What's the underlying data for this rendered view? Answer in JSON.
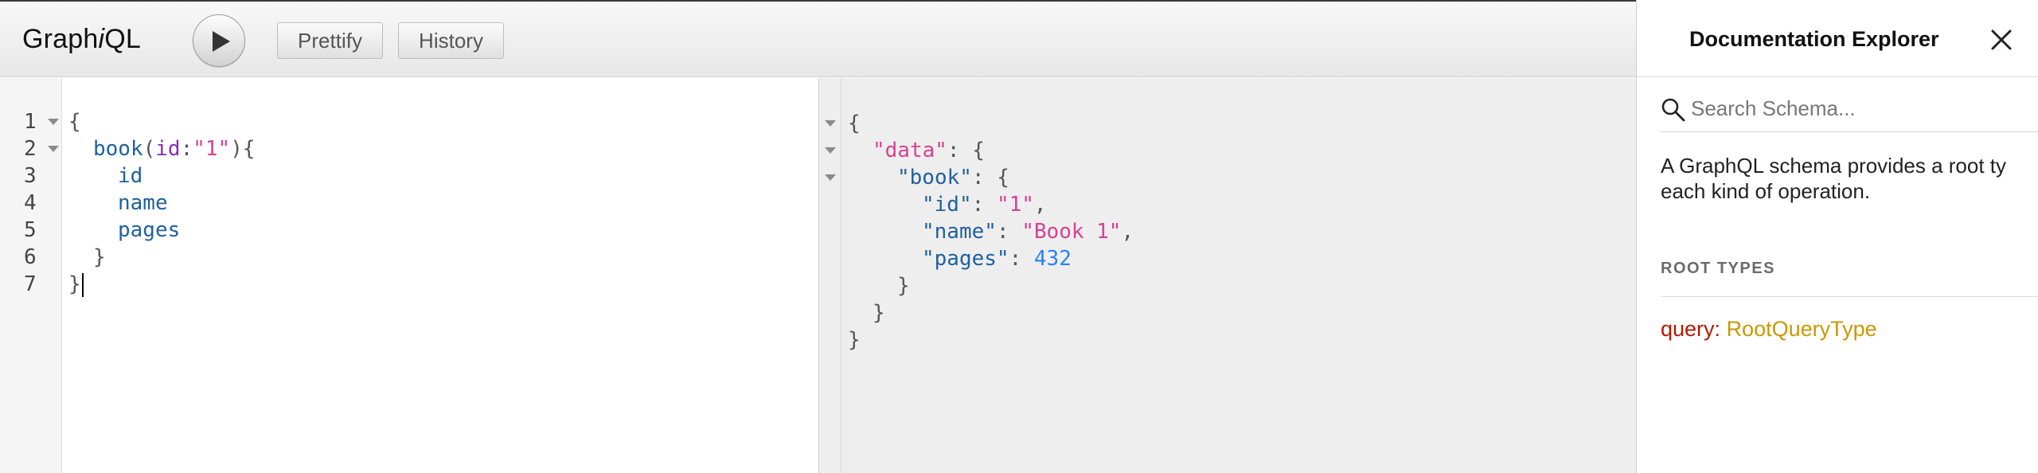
{
  "app": {
    "title_prefix": "Graph",
    "title_italic": "i",
    "title_suffix": "QL"
  },
  "toolbar": {
    "run_button": "play-icon",
    "prettify_label": "Prettify",
    "history_label": "History"
  },
  "query_editor": {
    "line_numbers": [
      "1",
      "2",
      "3",
      "4",
      "5",
      "6",
      "7"
    ],
    "lines": [
      {
        "tokens": [
          {
            "t": "{",
            "c": "punct"
          }
        ]
      },
      {
        "tokens": [
          {
            "t": "book",
            "c": "field"
          },
          {
            "t": "(",
            "c": "punct"
          },
          {
            "t": "id",
            "c": "arg"
          },
          {
            "t": ":",
            "c": "punct"
          },
          {
            "t": "\"1\"",
            "c": "str"
          },
          {
            "t": "){",
            "c": "punct"
          }
        ]
      },
      {
        "tokens": [
          {
            "t": "id",
            "c": "field"
          }
        ]
      },
      {
        "tokens": [
          {
            "t": "name",
            "c": "field"
          }
        ]
      },
      {
        "tokens": [
          {
            "t": "pages",
            "c": "field"
          }
        ]
      },
      {
        "tokens": [
          {
            "t": "}",
            "c": "punct"
          }
        ]
      },
      {
        "tokens": [
          {
            "t": "}",
            "c": "punct"
          }
        ]
      }
    ]
  },
  "result": {
    "lines": [
      {
        "tokens": [
          {
            "t": "{",
            "c": "punct"
          }
        ]
      },
      {
        "tokens": [
          {
            "t": "\"data\"",
            "c": "str"
          },
          {
            "t": ": {",
            "c": "punct"
          }
        ]
      },
      {
        "tokens": [
          {
            "t": "\"book\"",
            "c": "field"
          },
          {
            "t": ": {",
            "c": "punct"
          }
        ]
      },
      {
        "tokens": [
          {
            "t": "\"id\"",
            "c": "field"
          },
          {
            "t": ": ",
            "c": "punct"
          },
          {
            "t": "\"1\"",
            "c": "str"
          },
          {
            "t": ",",
            "c": "punct"
          }
        ]
      },
      {
        "tokens": [
          {
            "t": "\"name\"",
            "c": "field"
          },
          {
            "t": ": ",
            "c": "punct"
          },
          {
            "t": "\"Book 1\"",
            "c": "str"
          },
          {
            "t": ",",
            "c": "punct"
          }
        ]
      },
      {
        "tokens": [
          {
            "t": "\"pages\"",
            "c": "field"
          },
          {
            "t": ": ",
            "c": "punct"
          },
          {
            "t": "432",
            "c": "num"
          }
        ]
      },
      {
        "tokens": [
          {
            "t": "}",
            "c": "punct"
          }
        ]
      },
      {
        "tokens": [
          {
            "t": "}",
            "c": "punct"
          }
        ]
      },
      {
        "tokens": [
          {
            "t": "}",
            "c": "punct"
          }
        ]
      }
    ]
  },
  "docs": {
    "title": "Documentation Explorer",
    "close_icon": "close-icon",
    "search_placeholder": "Search Schema...",
    "description": "A GraphQL schema provides a root type for each kind of operation.",
    "description_line1": "A GraphQL schema provides a root ty",
    "description_line2": "each kind of operation.",
    "root_types_label": "ROOT TYPES",
    "root_types": [
      {
        "keyword": "query",
        "separator": ": ",
        "type": "RootQueryType"
      }
    ]
  },
  "colors": {
    "field": "#1f61a0",
    "argument": "#8b2bb9",
    "string": "#d64292",
    "number": "#2882f9",
    "keyword": "#b11a04",
    "type_link": "#ca9800"
  }
}
